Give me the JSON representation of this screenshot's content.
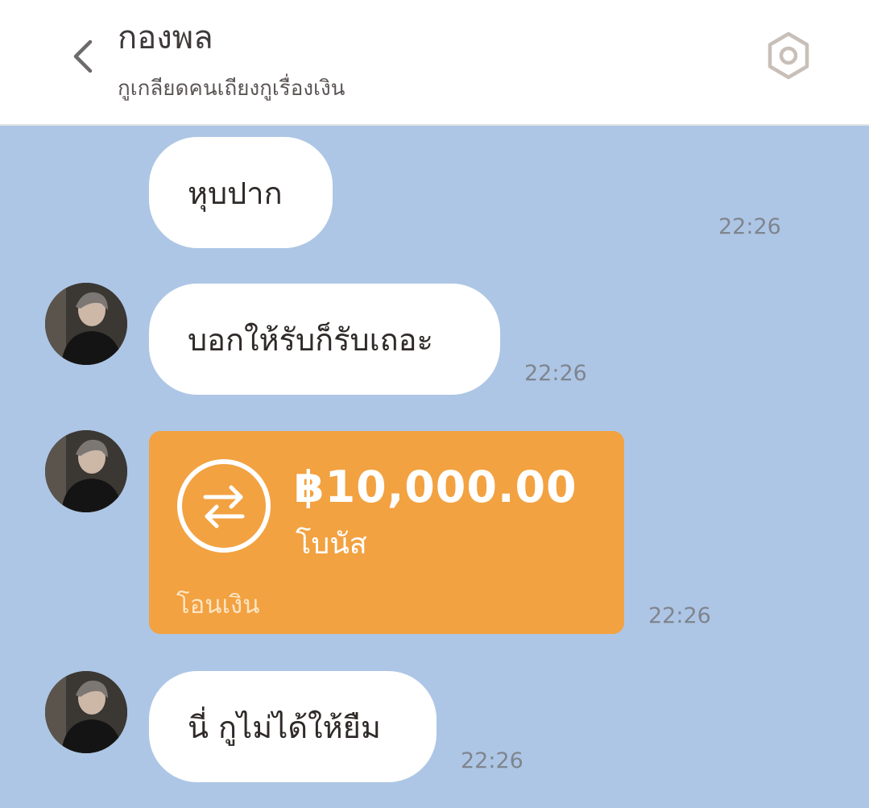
{
  "header": {
    "title": "กองพล",
    "subtitle": "กูเกลียดคนเถียงกูเรื่องเงิน",
    "back_icon": "chevron-left-icon",
    "settings_icon": "hexagon-settings-icon"
  },
  "messages": [
    {
      "type": "text",
      "text": "หุบปาก",
      "time": "22:26",
      "has_avatar": false
    },
    {
      "type": "text",
      "text": "บอกให้รับก็รับเถอะ",
      "time": "22:26",
      "has_avatar": true
    },
    {
      "type": "transfer",
      "amount": "฿10,000.00",
      "note": "โบนัส",
      "label": "โอนเงิน",
      "time": "22:26",
      "has_avatar": true,
      "icon": "transfer-arrows-icon"
    },
    {
      "type": "text",
      "text": "นี่ กูไม่ได้ให้ยืม",
      "time": "22:26",
      "has_avatar": true
    }
  ],
  "colors": {
    "chat_background": "#aec6e5",
    "bubble": "#ffffff",
    "transfer_card": "#f2a241",
    "timestamp": "#7f858f"
  }
}
